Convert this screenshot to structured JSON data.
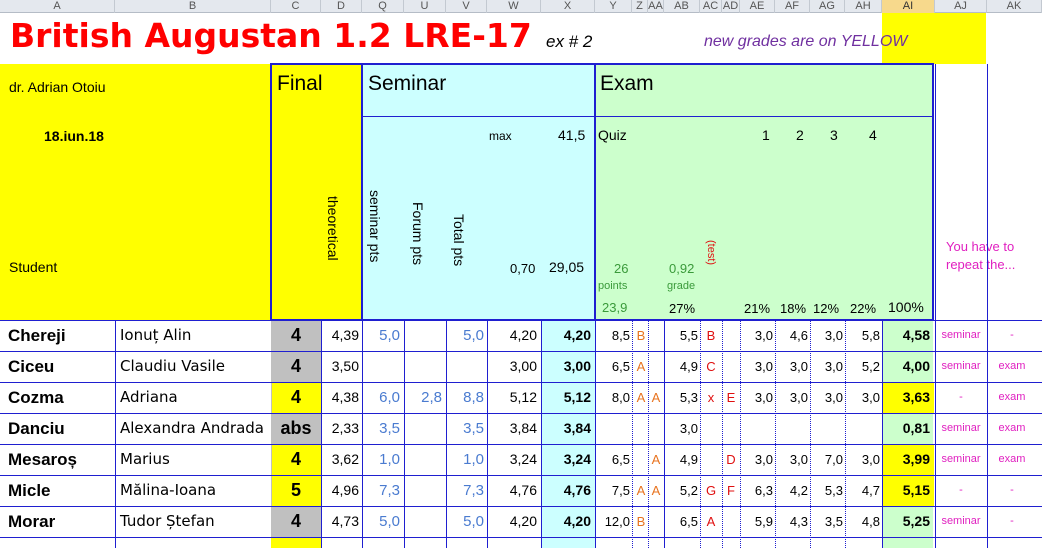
{
  "column_letters": [
    "A",
    "B",
    "C",
    "D",
    "Q",
    "U",
    "V",
    "W",
    "X",
    "Y",
    "Z",
    "AA",
    "AB",
    "AC",
    "AD",
    "AE",
    "AF",
    "AG",
    "AH",
    "AI",
    "AJ",
    "AK"
  ],
  "title": "British Augustan 1.2 LRE-17",
  "exercise": "ex # 2",
  "note": "new grades are on YELLOW",
  "teacher": "dr. Adrian Otoiu",
  "date": "18.iun.18",
  "student_label": "Student",
  "sections": {
    "final": "Final",
    "seminar": "Seminar",
    "exam": "Exam"
  },
  "final_sub": "theoretical",
  "seminar_cols": {
    "seminar_pts": "seminar pts",
    "forum_pts": "Forum pts",
    "total_pts": "Total pts"
  },
  "max_label": "max",
  "max_value": "41,5",
  "seminar_factor": "0,70",
  "seminar_total": "29,05",
  "quiz_label": "Quiz",
  "quiz_numbers": [
    "1",
    "2",
    "3",
    "4"
  ],
  "exam_points": "26",
  "exam_points_label": "points",
  "exam_grade": "0,92",
  "exam_grade_label": "grade",
  "test_label": "(test)",
  "exam_min": "23,9",
  "percentages": {
    "grade": "27%",
    "q1": "21%",
    "q2": "18%",
    "q3": "12%",
    "q4": "22%",
    "total": "100%"
  },
  "repeat_label": "You have to repeat the...",
  "colors": {
    "yellow": "#ffff00",
    "cyan": "#ccffff",
    "green": "#ccffcc",
    "border_blue": "#1f1fd0",
    "title_red": "#ff0000",
    "note_purple": "#7030a0"
  },
  "students": [
    {
      "last": "Chereji",
      "first": "Ionuț Alin",
      "final": "4",
      "final_yellow": false,
      "theoretical": "4,39",
      "seminar_pts": "5,0",
      "forum_pts": "",
      "total_pts": "5,0",
      "w": "4,20",
      "x": "4,20",
      "y": "8,5",
      "z": "B",
      "aa": "",
      "ab": "5,5",
      "ac": "B",
      "ad": "",
      "ae": "3,0",
      "af": "4,6",
      "ag": "3,0",
      "ah": "5,8",
      "ai": "4,58",
      "ai_yellow": false,
      "aj": "seminar",
      "ak": "-"
    },
    {
      "last": "Ciceu",
      "first": "Claudiu Vasile",
      "final": "4",
      "final_yellow": false,
      "theoretical": "3,50",
      "seminar_pts": "",
      "forum_pts": "",
      "total_pts": "",
      "w": "3,00",
      "x": "3,00",
      "y": "6,5",
      "z": "A",
      "aa": "",
      "ab": "4,9",
      "ac": "C",
      "ad": "",
      "ae": "3,0",
      "af": "3,0",
      "ag": "3,0",
      "ah": "5,2",
      "ai": "4,00",
      "ai_yellow": false,
      "aj": "seminar",
      "ak": "exam"
    },
    {
      "last": "Cozma",
      "first": "Adriana",
      "final": "4",
      "final_yellow": true,
      "theoretical": "4,38",
      "seminar_pts": "6,0",
      "forum_pts": "2,8",
      "total_pts": "8,8",
      "w": "5,12",
      "x": "5,12",
      "y": "8,0",
      "z": "A",
      "aa": "A",
      "ab": "5,3",
      "ac": "x",
      "ad": "E",
      "ae": "3,0",
      "af": "3,0",
      "ag": "3,0",
      "ah": "3,0",
      "ai": "3,63",
      "ai_yellow": true,
      "aj": "-",
      "ak": "exam"
    },
    {
      "last": "Danciu",
      "first": "Alexandra Andrada",
      "final": "abs",
      "final_yellow": false,
      "theoretical": "2,33",
      "seminar_pts": "3,5",
      "forum_pts": "",
      "total_pts": "3,5",
      "w": "3,84",
      "x": "3,84",
      "y": "",
      "z": "",
      "aa": "",
      "ab": "3,0",
      "ac": "",
      "ad": "",
      "ae": "",
      "af": "",
      "ag": "",
      "ah": "",
      "ai": "0,81",
      "ai_yellow": false,
      "aj": "seminar",
      "ak": "exam"
    },
    {
      "last": "Mesaroș",
      "first": "Marius",
      "final": "4",
      "final_yellow": true,
      "theoretical": "3,62",
      "seminar_pts": "1,0",
      "forum_pts": "",
      "total_pts": "1,0",
      "w": "3,24",
      "x": "3,24",
      "y": "6,5",
      "z": "",
      "aa": "A",
      "ab": "4,9",
      "ac": "",
      "ad": "D",
      "ae": "3,0",
      "af": "3,0",
      "ag": "7,0",
      "ah": "3,0",
      "ai": "3,99",
      "ai_yellow": true,
      "aj": "seminar",
      "ak": "exam"
    },
    {
      "last": "Micle",
      "first": "Mălina-Ioana",
      "final": "5",
      "final_yellow": true,
      "theoretical": "4,96",
      "seminar_pts": "7,3",
      "forum_pts": "",
      "total_pts": "7,3",
      "w": "4,76",
      "x": "4,76",
      "y": "7,5",
      "z": "A",
      "aa": "A",
      "ab": "5,2",
      "ac": "G",
      "ad": "F",
      "ae": "6,3",
      "af": "4,2",
      "ag": "5,3",
      "ah": "4,7",
      "ai": "5,15",
      "ai_yellow": true,
      "aj": "-",
      "ak": "-"
    },
    {
      "last": "Morar",
      "first": "Tudor Ștefan",
      "final": "4",
      "final_yellow": false,
      "theoretical": "4,73",
      "seminar_pts": "5,0",
      "forum_pts": "",
      "total_pts": "5,0",
      "w": "4,20",
      "x": "4,20",
      "y": "12,0",
      "z": "B",
      "aa": "",
      "ab": "6,5",
      "ac": "A",
      "ad": "",
      "ae": "5,9",
      "af": "4,3",
      "ag": "3,5",
      "ah": "4,8",
      "ai": "5,25",
      "ai_yellow": false,
      "aj": "seminar",
      "ak": "-"
    }
  ]
}
